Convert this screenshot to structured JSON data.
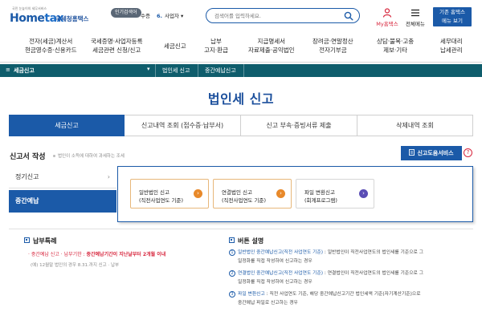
{
  "header": {
    "logo_tagline": "국민 눈높이의 세무서비스",
    "logo_mark_a": "Home",
    "logo_mark_b": "tax",
    "logo_home": "국세청홈택스",
    "trend_badge": "인기검색어",
    "trend_prev": "수증",
    "trend_num": "6.",
    "trend_word": "사업자",
    "trend_arrow": "▾",
    "search_placeholder": "검색어를 입력하세요.",
    "my_hometax": "My홈택스",
    "all_menu": "전체메뉴",
    "old_version_line1": "기존 홈택스",
    "old_version_line2": "메뉴 보기"
  },
  "gnb": [
    {
      "line1": "전자(세금)계산서",
      "line2": "현금영수증·신용카드"
    },
    {
      "line1": "국세증명·사업자등록",
      "line2": "세금관련 신청/신고"
    },
    {
      "line1": "세금신고",
      "line2": ""
    },
    {
      "line1": "납부",
      "line2": "고지·환급"
    },
    {
      "line1": "지급명세서",
      "line2": "자료제출·공익법인"
    },
    {
      "line1": "장려금·연말정산",
      "line2": "전자기부금"
    },
    {
      "line1": "상담·불복·고충",
      "line2": "제보·기타"
    },
    {
      "line1": "세무대리",
      "line2": "납세관리"
    }
  ],
  "breadcrumb": {
    "home": "세금신고",
    "level1": "법인세 신고",
    "level2": "중간예납신고",
    "chevron": "▾"
  },
  "page_title": "법인세 신고",
  "tabs": [
    {
      "label": "세금신고",
      "active": true
    },
    {
      "label": "신고내역 조회 (접수증·납부서)",
      "active": false
    },
    {
      "label": "신고 부속·증빙서류 제출",
      "active": false
    },
    {
      "label": "삭제내역 조회",
      "active": false
    }
  ],
  "filing": {
    "title": "신고서 작성",
    "subtitle": "법인이 소득에 대하여 과세하는 조세",
    "guide_button": "신고도움서비스",
    "help": "?",
    "side_options": [
      {
        "label": "정기신고",
        "arrow": "›"
      },
      {
        "label": "중간예납",
        "arrow": ""
      }
    ],
    "cards": [
      {
        "line1": "일반법인 신고",
        "line2": "(직전사업연도 기준)",
        "go": "›"
      },
      {
        "line1": "연결법인 신고",
        "line2": "(직전사업연도 기준)",
        "go": "›"
      },
      {
        "line1": "파일 변환신고",
        "line2": "(회계프로그램)",
        "go": "›"
      }
    ]
  },
  "payment_notice": {
    "title": "납부특례",
    "line_prefix": "· 중간예납 신고 · 납부기한 : ",
    "line_highlight": "중간예납기간이 지난날부터 2개월 이내",
    "note": "(예) 12월말 법인의 경우 8.31.까지 신고 · 납부"
  },
  "button_desc": {
    "title": "버튼 설명",
    "items": [
      {
        "num": "1",
        "hl": "일반법인 중간예납신고(직전 사업연도 기준)",
        "rest": " : 일반법인이 직전사업연도의 법인세를 기준으로 그",
        "line2": "일정화를 직접 작성하여 신고하는 경우"
      },
      {
        "num": "2",
        "hl": "연결법인 중간예납신고(직전 사업연도 기준)",
        "rest": " : 연결법인이 직전사업연도의 법인세를 기준으로 그",
        "line2": "일정화를 직접 작성하여 신고하는 경우"
      },
      {
        "num": "3",
        "hl": "파일 변환신고",
        "rest": " : 직전 사업연도 기준, 해당 중간예납신고기간 법인세액 기준(자기계산기준)으로",
        "line2": "중간예납 파일로 신고하는 경우"
      }
    ]
  },
  "colors": {
    "brand": "#1b5aa8",
    "teal_bar": "#0f5d6c",
    "alert": "#d7263d",
    "card_border": "#e7b77a"
  }
}
